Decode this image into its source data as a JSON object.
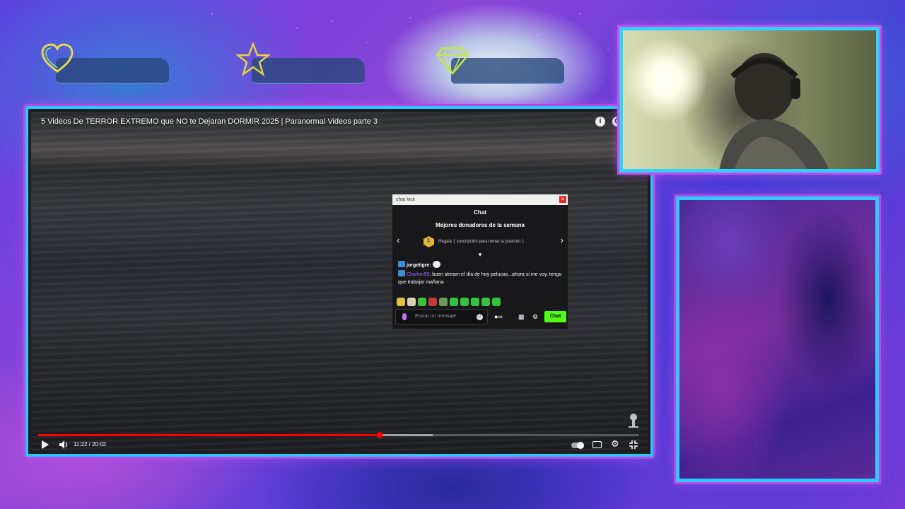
{
  "video": {
    "title": "5 Videos De TERROR EXTREMO que NO te Dejaran DORMIR 2025 | Paranormal Videos parte 3",
    "time": "11:22 / 20:02",
    "progress_fraction": 0.568,
    "buffer_fraction": 0.657,
    "info_icon": "i"
  },
  "chat": {
    "window_title": "chat kick",
    "close_label": "×",
    "header": "Chat",
    "top_donors_title": "Mejores donadores de la semana",
    "donor_rank": "1",
    "donor_prompt": "Regala 1 suscripción para tomar la posición 1",
    "messages": [
      {
        "user": "jorgetigre:",
        "text": ""
      },
      {
        "user": "Charlon50",
        "text": ": buen stream el día de hoy pelucas...ahora si me voy, tengo que trabajar mañana"
      }
    ],
    "input_placeholder": "Enviar un mensaje",
    "send_label": "Chat"
  },
  "colors": {
    "accent_border": "#27c7ff",
    "glow": "#b64be8",
    "kick_green": "#53fc18",
    "youtube_red": "#ff0000"
  },
  "icons": {
    "stats": [
      "heart-icon",
      "star-icon",
      "diamond-icon"
    ],
    "player": [
      "play-icon",
      "volume-icon",
      "autoplay-toggle",
      "subtitles-icon",
      "settings-icon",
      "exit-fullscreen-icon"
    ]
  }
}
